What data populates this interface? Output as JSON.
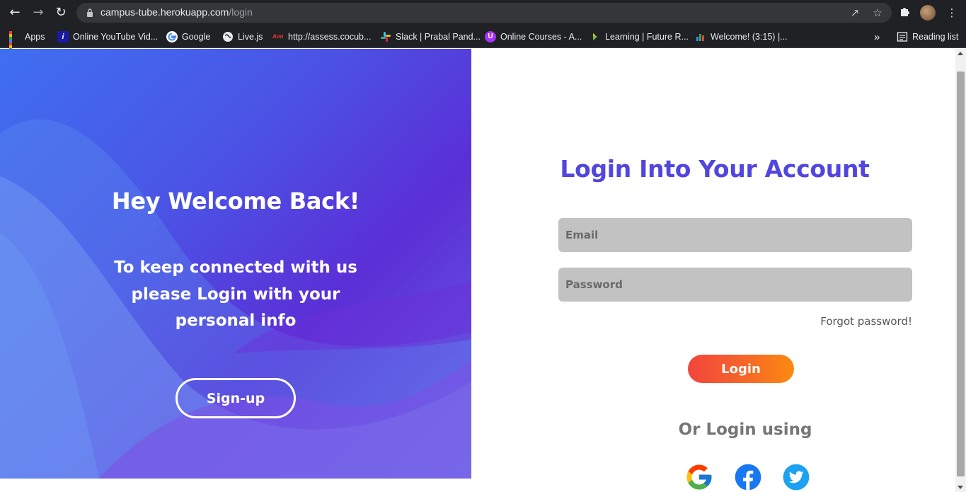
{
  "browser": {
    "url_host": "campus-tube.herokuapp.com",
    "url_path": "/login",
    "bookmarks": [
      {
        "label": "Apps",
        "icon": "apps-grid-icon"
      },
      {
        "label": "Online YouTube Vid...",
        "icon": "youtube-downloader-icon"
      },
      {
        "label": "Google",
        "icon": "google-icon"
      },
      {
        "label": "Live.js",
        "icon": "globe-icon"
      },
      {
        "label": "http://assess.cocub...",
        "icon": "cocubes-icon"
      },
      {
        "label": "Slack | Prabal Pand...",
        "icon": "slack-icon"
      },
      {
        "label": "Online Courses - A...",
        "icon": "udemy-icon"
      },
      {
        "label": "Learning | Future R...",
        "icon": "futurelearn-icon"
      },
      {
        "label": "Welcome! (3:15) |...",
        "icon": "colorful-icon"
      }
    ],
    "overflow_label": "»",
    "reading_list_label": "Reading list"
  },
  "hero": {
    "title": "Hey Welcome Back!",
    "subtitle": "To keep connected with us please Login with your personal info",
    "signup_label": "Sign-up"
  },
  "login": {
    "title": "Login Into Your Account",
    "email_placeholder": "Email",
    "password_placeholder": "Password",
    "forgot_label": "Forgot password!",
    "login_label": "Login",
    "or_login_label": "Or Login using",
    "social": [
      {
        "name": "google",
        "icon": "google-icon"
      },
      {
        "name": "facebook",
        "icon": "facebook-icon"
      },
      {
        "name": "twitter",
        "icon": "twitter-icon"
      }
    ]
  },
  "colors": {
    "accent_title": "#5146e0",
    "login_gradient_start": "#f2453d",
    "login_gradient_end": "#fb8a10",
    "hero_gradient": [
      "#3f6ff0",
      "#5b2fd6"
    ]
  }
}
